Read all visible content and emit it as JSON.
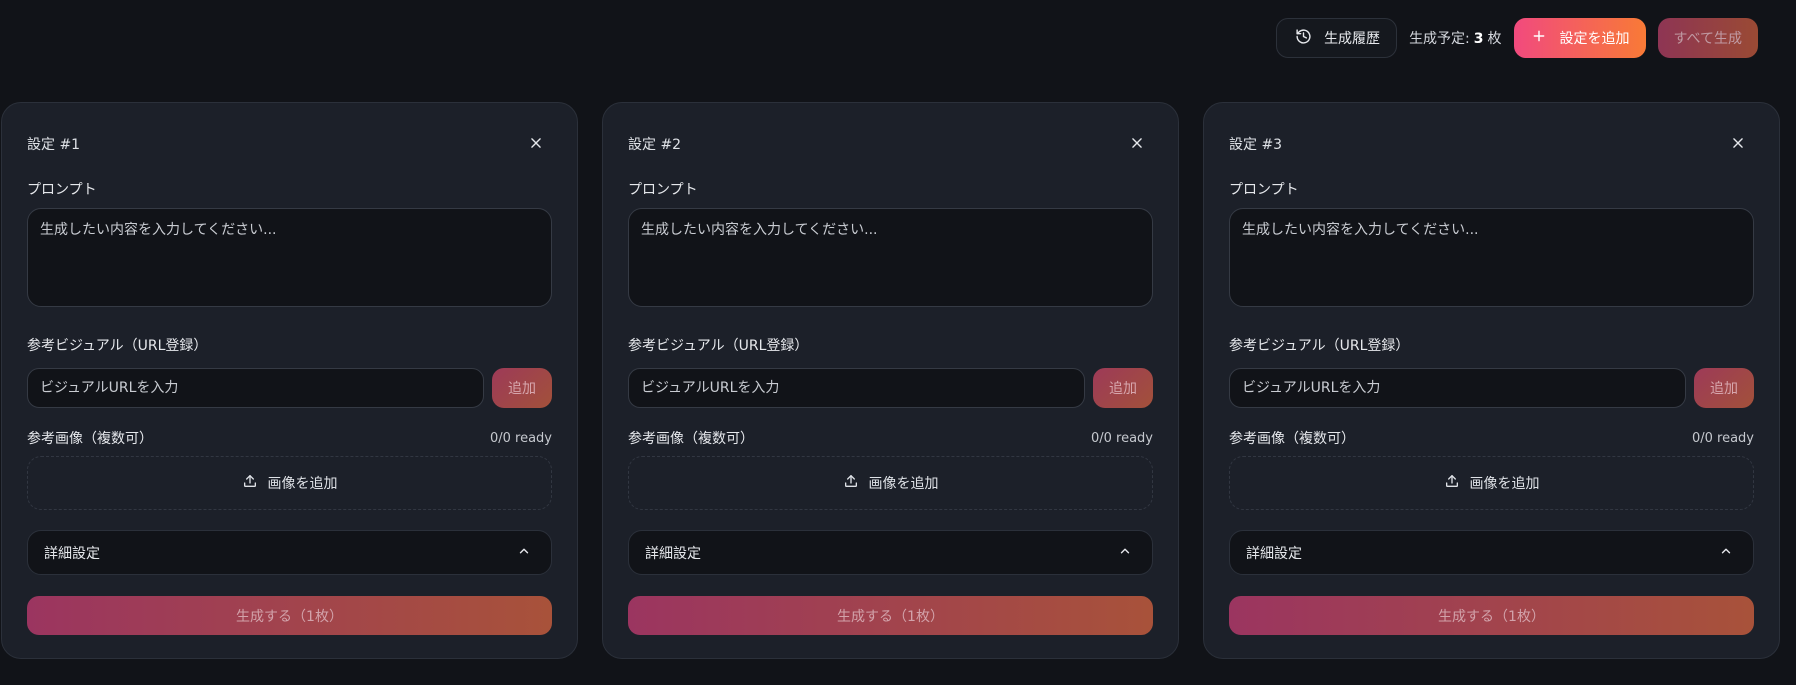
{
  "toolbar": {
    "history_label": "生成履歴",
    "count_prefix": "生成予定:",
    "count_value": "3",
    "count_unit": "枚",
    "add_label": "設定を追加",
    "generate_all_label": "すべて生成"
  },
  "cards": [
    {
      "title": "設定 #1",
      "prompt_label": "プロンプト",
      "prompt_placeholder": "生成したい内容を入力してください...",
      "visual_label": "参考ビジュアル（URL登録）",
      "url_placeholder": "ビジュアルURLを入力",
      "url_add_label": "追加",
      "images_label": "参考画像（複数可）",
      "images_status": "0/0 ready",
      "upload_label": "画像を追加",
      "details_label": "詳細設定",
      "generate_label": "生成する（1枚）"
    },
    {
      "title": "設定 #2",
      "prompt_label": "プロンプト",
      "prompt_placeholder": "生成したい内容を入力してください...",
      "visual_label": "参考ビジュアル（URL登録）",
      "url_placeholder": "ビジュアルURLを入力",
      "url_add_label": "追加",
      "images_label": "参考画像（複数可）",
      "images_status": "0/0 ready",
      "upload_label": "画像を追加",
      "details_label": "詳細設定",
      "generate_label": "生成する（1枚）"
    },
    {
      "title": "設定 #3",
      "prompt_label": "プロンプト",
      "prompt_placeholder": "生成したい内容を入力してください...",
      "visual_label": "参考ビジュアル（URL登録）",
      "url_placeholder": "ビジュアルURLを入力",
      "url_add_label": "追加",
      "images_label": "参考画像（複数可）",
      "images_status": "0/0 ready",
      "upload_label": "画像を追加",
      "details_label": "詳細設定",
      "generate_label": "生成する（1枚）"
    }
  ],
  "icons": {
    "history": "history-icon",
    "plus": "plus-icon",
    "close": "close-icon",
    "upload": "upload-icon",
    "chevron": "chevron-up-icon"
  },
  "colors": {
    "background": "#111318",
    "card": "#1c2029",
    "accent_start": "#f14a7e",
    "accent_end": "#f87a36"
  }
}
